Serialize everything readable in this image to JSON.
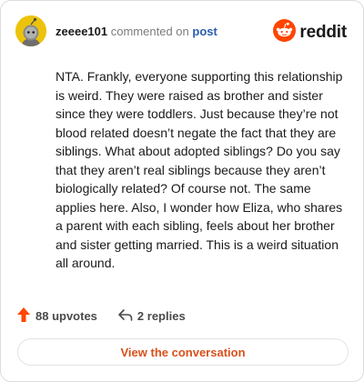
{
  "header": {
    "username": "zeeee101",
    "action_text": "commented on",
    "post_link": "post",
    "brand": "reddit"
  },
  "comment": {
    "body": "NTA. Frankly, everyone supporting this relationship is weird. They were raised as brother and sister since they were toddlers. Just because they’re not blood related doesn’t negate the fact that they are siblings. What about adopted siblings? Do you say that they aren’t real siblings because they aren’t biologically related? Of course not. The same applies here. Also, I wonder how Eliza, who shares a parent with each sibling, feels about her brother and sister getting married. This is a weird situation all around."
  },
  "actions": {
    "upvotes": "88 upvotes",
    "replies": "2 replies"
  },
  "footer": {
    "view_button": "View the conversation"
  },
  "colors": {
    "avatar_bg": "#ecc30b",
    "reddit_orange": "#ff4500",
    "upvote": "#ff4500",
    "link_blue": "#2a5db0",
    "view_button_text": "#d9501a"
  },
  "icons": {
    "avatar": "snoo-avatar-icon",
    "brand": "reddit-logo-icon",
    "upvote": "upvote-arrow-icon",
    "reply": "reply-arrow-icon"
  }
}
